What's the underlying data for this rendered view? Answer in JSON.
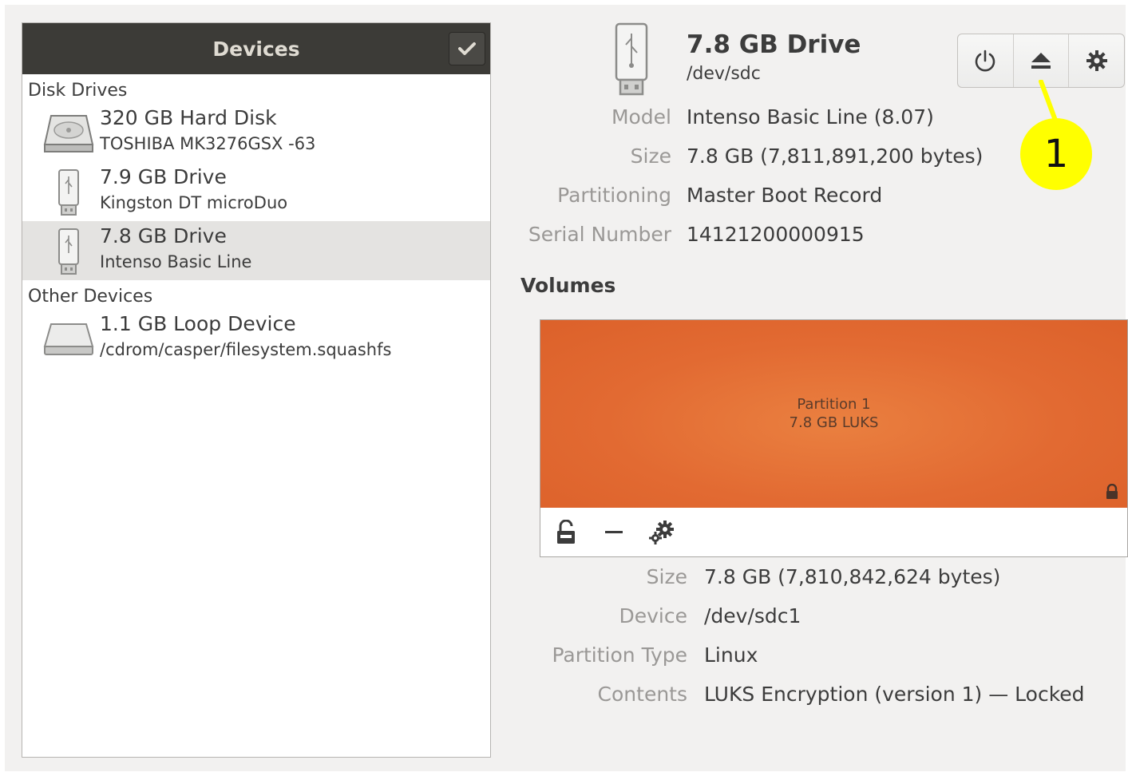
{
  "sidebar": {
    "title": "Devices",
    "sections": [
      {
        "label": "Disk Drives",
        "devices": [
          {
            "name": "320 GB Hard Disk",
            "detail": "TOSHIBA MK3276GSX -63",
            "icon": "hard-disk-icon",
            "selected": false
          },
          {
            "name": "7.9 GB Drive",
            "detail": "Kingston DT microDuo",
            "icon": "usb-drive-icon",
            "selected": false
          },
          {
            "name": "7.8 GB Drive",
            "detail": "Intenso Basic Line",
            "icon": "usb-drive-icon",
            "selected": true
          }
        ]
      },
      {
        "label": "Other Devices",
        "devices": [
          {
            "name": "1.1 GB Loop Device",
            "detail": "/cdrom/casper/filesystem.squashfs",
            "icon": "loop-device-icon",
            "selected": false
          }
        ]
      }
    ]
  },
  "drive": {
    "title": "7.8 GB Drive",
    "path": "/dev/sdc",
    "properties": [
      {
        "label": "Model",
        "value": "Intenso Basic Line (8.07)"
      },
      {
        "label": "Size",
        "value": "7.8 GB (7,811,891,200 bytes)"
      },
      {
        "label": "Partitioning",
        "value": "Master Boot Record"
      },
      {
        "label": "Serial Number",
        "value": "14121200000915"
      }
    ]
  },
  "toolbar": {
    "buttons": [
      "power-off-icon",
      "eject-icon",
      "settings-icon"
    ]
  },
  "annotation": {
    "label": "1",
    "color": "#ffff00"
  },
  "volumes": {
    "heading": "Volumes",
    "partition": {
      "name": "Partition 1",
      "size": "7.8 GB LUKS",
      "color": "#e26a32"
    },
    "toolbar": [
      "unlock-icon",
      "minus-icon",
      "gears-icon"
    ],
    "properties": [
      {
        "label": "Size",
        "value": "7.8 GB (7,810,842,624 bytes)"
      },
      {
        "label": "Device",
        "value": "/dev/sdc1"
      },
      {
        "label": "Partition Type",
        "value": "Linux"
      },
      {
        "label": "Contents",
        "value": "LUKS Encryption (version 1) — Locked"
      }
    ]
  }
}
